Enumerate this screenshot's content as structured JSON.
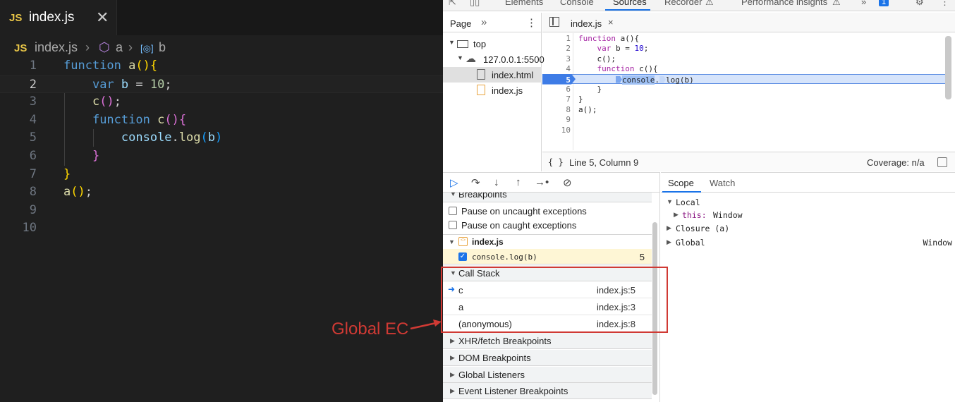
{
  "vscode": {
    "tab": {
      "badge": "JS",
      "label": "index.js",
      "close": "✕"
    },
    "breadcrumb": {
      "badge": "JS",
      "file": "index.js",
      "sep1": "›",
      "fn": "a",
      "sep2": "›",
      "var": "b"
    },
    "code": {
      "line_numbers": [
        "1",
        "2",
        "3",
        "4",
        "5",
        "6",
        "7",
        "8",
        "9",
        "10"
      ],
      "active_line": 2
    }
  },
  "devtools": {
    "top_tabs": [
      "Elements",
      "Console",
      "Sources",
      "Recorder",
      "Performance insights",
      "1"
    ],
    "active_tab": "Sources",
    "navigator": {
      "tab": "Page",
      "tree": [
        {
          "label": "top"
        },
        {
          "label": "127.0.0.1:5500"
        },
        {
          "label": "index.html"
        },
        {
          "label": "index.js"
        }
      ]
    },
    "editor": {
      "file_tab": "index.js",
      "close": "×",
      "line_numbers": [
        "1",
        "2",
        "3",
        "4",
        "5",
        "6",
        "7",
        "8",
        "9",
        "10"
      ],
      "breakpoint_line": "5",
      "status_position": "Line 5, Column 9",
      "status_coverage": "Coverage: n/a",
      "format_icon": "{ }"
    },
    "debugger": {
      "breakpoints_header": "Breakpoints",
      "pause_uncaught": "Pause on uncaught exceptions",
      "pause_caught": "Pause on caught exceptions",
      "bp_file": "index.js",
      "bp_code": "console.log(b)",
      "bp_line": "5",
      "call_stack_header": "Call Stack",
      "call_stack": [
        {
          "fn": "c",
          "loc": "index.js:5"
        },
        {
          "fn": "a",
          "loc": "index.js:3"
        },
        {
          "fn": "(anonymous)",
          "loc": "index.js:8"
        }
      ],
      "sections": [
        "XHR/fetch Breakpoints",
        "DOM Breakpoints",
        "Global Listeners",
        "Event Listener Breakpoints"
      ]
    },
    "scope": {
      "tabs": [
        "Scope",
        "Watch"
      ],
      "local": "Local",
      "this_key": "this:",
      "this_val": "Window",
      "closure": "Closure (a)",
      "global": "Global",
      "global_val": "Window"
    }
  },
  "annotation": {
    "label": "Global EC",
    "color": "#d03a34"
  }
}
